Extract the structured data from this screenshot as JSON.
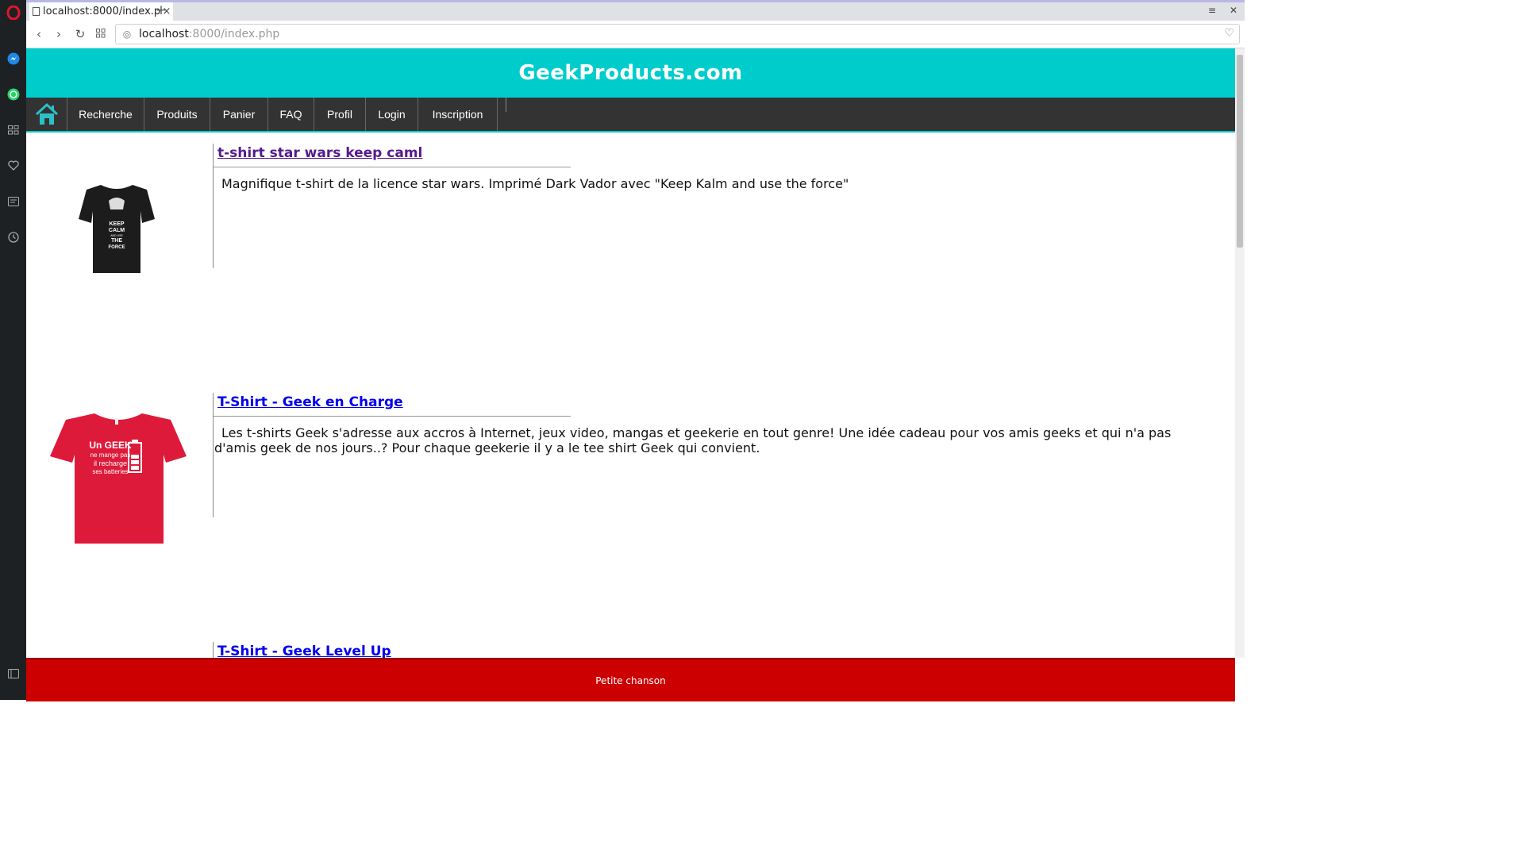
{
  "browser": {
    "tab_title": "localhost:8000/index.php",
    "new_tab_label": "+",
    "url_host": "localhost",
    "url_path": ":8000/index.php",
    "menu_icon": "≡",
    "close_icon": "✕"
  },
  "site": {
    "title": "GeekProducts.com",
    "footer_text": "Petite chanson"
  },
  "nav": {
    "items": [
      "Recherche",
      "Produits",
      "Panier",
      "FAQ",
      "Profil",
      "Login",
      "Inscription"
    ]
  },
  "products": [
    {
      "title": "t-shirt star wars keep caml",
      "description": "Magnifique t-shirt de la licence star wars. Imprimé Dark Vador avec \"Keep Kalm and use the force\"",
      "image_text": [
        "KEEP",
        "CALM",
        "AND USE",
        "THE",
        "FORCE"
      ],
      "visited": true
    },
    {
      "title": "T-Shirt - Geek en Charge",
      "description": "Les t-shirts Geek s'adresse aux accros à Internet, jeux video, mangas et geekerie en tout genre! Une idée cadeau pour vos amis geeks et qui n'a pas d'amis geek de nos jours..? Pour chaque geekerie il y a le tee shirt Geek qui convient.",
      "image_text": [
        "Un GEEK",
        "ne mange pas",
        "il recharge",
        "ses batteries"
      ],
      "visited": false
    },
    {
      "title": "T-Shirt - Geek Level Up",
      "visited": false
    }
  ],
  "colors": {
    "header_bg": "#00cccc",
    "nav_bg": "#333333",
    "footer_bg": "#cc0000",
    "link_visited": "#551a8b",
    "link": "#0000ee"
  }
}
